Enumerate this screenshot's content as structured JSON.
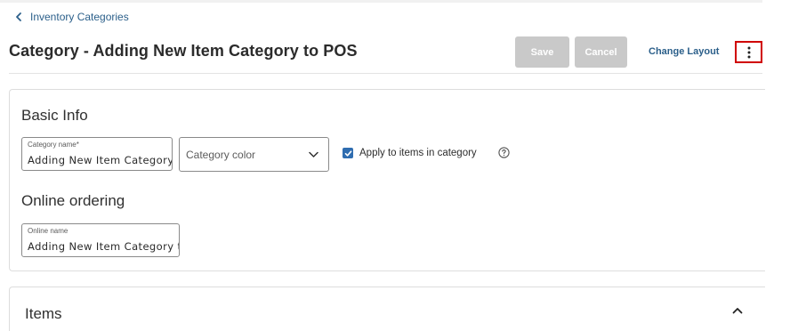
{
  "breadcrumb": {
    "label": "Inventory Categories",
    "icon": "chevron-left-icon"
  },
  "header": {
    "title": "Category - Adding New Item Category to POS",
    "save_label": "Save",
    "cancel_label": "Cancel",
    "change_layout_label": "Change Layout",
    "more_icon": "more-vertical-icon"
  },
  "basic_info": {
    "title": "Basic Info",
    "category_name": {
      "label": "Category name*",
      "value": "Adding New Item Category"
    },
    "category_color": {
      "placeholder": "Category color",
      "icon": "chevron-down-icon"
    },
    "apply_checkbox": {
      "label": "Apply to items in category",
      "checked": true
    },
    "help_icon": "question-circle-icon"
  },
  "online_ordering": {
    "title": "Online ordering",
    "online_name": {
      "label": "Online name",
      "value": "Adding New Item Category to"
    }
  },
  "items": {
    "title": "Items",
    "icon": "chevron-up-icon"
  },
  "colors": {
    "link": "#2b5f8a",
    "button_disabled": "#c9c9c9",
    "checkbox": "#2f6db0",
    "highlight": "#d00000"
  }
}
